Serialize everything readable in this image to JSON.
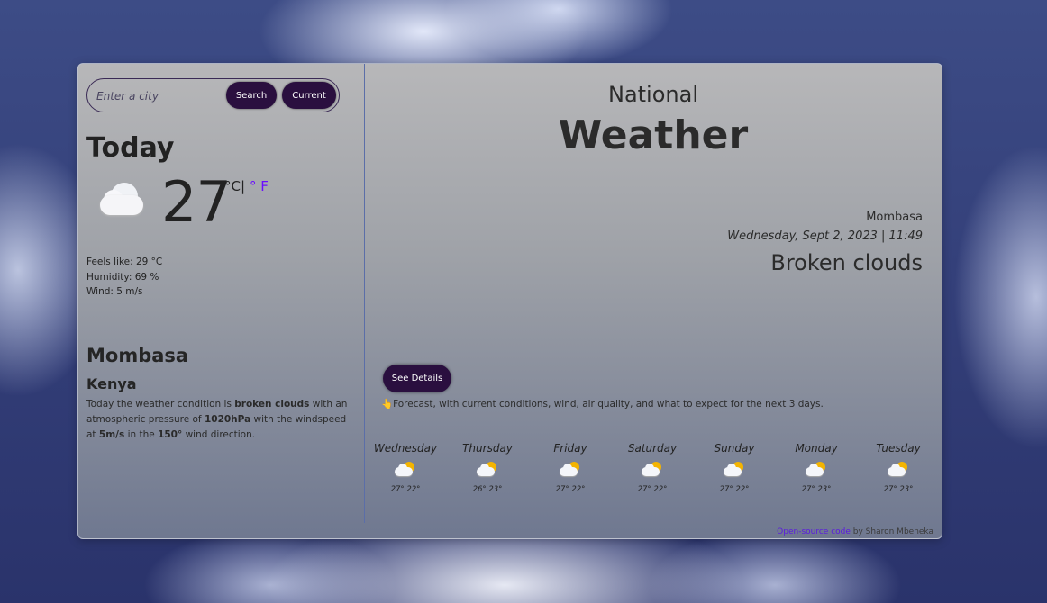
{
  "search": {
    "placeholder": "Enter a city",
    "search_label": "Search",
    "current_label": "Current"
  },
  "today": {
    "heading": "Today",
    "icon": "cloud-icon",
    "temperature": "27",
    "unit_c": "°C",
    "unit_sep": "|",
    "unit_f": "° F",
    "feels_like": "Feels like: 29 °C",
    "humidity": "Humidity: 69 %",
    "wind": "Wind: 5 m/s",
    "city": "Mombasa",
    "country": "Kenya",
    "desc_1": "Today the weather condition is ",
    "desc_condition": "broken clouds",
    "desc_2": " with an atmospheric pressure of ",
    "desc_pressure": "1020hPa",
    "desc_3": " with the windspeed at ",
    "desc_windspeed": "5m/s",
    "desc_4": " in the ",
    "desc_direction": "150°",
    "desc_5": " wind direction."
  },
  "header": {
    "line1": "National",
    "line2": "Weather"
  },
  "location": {
    "city": "Mombasa",
    "datetime": "Wednesday, Sept 2, 2023 | 11:49",
    "condition": "Broken clouds"
  },
  "details": {
    "button_label": "See Details",
    "hint": "👆Forecast, with current conditions, wind, air quality, and what to expect for the next 3 days."
  },
  "forecast": [
    {
      "day": "Wednesday",
      "temps": "27° 22°",
      "icon": "partly-cloudy-icon"
    },
    {
      "day": "Thursday",
      "temps": "26° 23°",
      "icon": "partly-cloudy-icon"
    },
    {
      "day": "Friday",
      "temps": "27° 22°",
      "icon": "partly-cloudy-icon"
    },
    {
      "day": "Saturday",
      "temps": "27° 22°",
      "icon": "partly-cloudy-icon"
    },
    {
      "day": "Sunday",
      "temps": "27° 22°",
      "icon": "partly-cloudy-icon"
    },
    {
      "day": "Monday",
      "temps": "27° 23°",
      "icon": "partly-cloudy-icon"
    },
    {
      "day": "Tuesday",
      "temps": "27° 23°",
      "icon": "partly-cloudy-icon"
    }
  ],
  "footer": {
    "link_text": "Open-source code",
    "by_text": " by Sharon Mbeneka"
  },
  "colors": {
    "button": "#2a0f3f",
    "accent_link": "#6a0dff"
  }
}
